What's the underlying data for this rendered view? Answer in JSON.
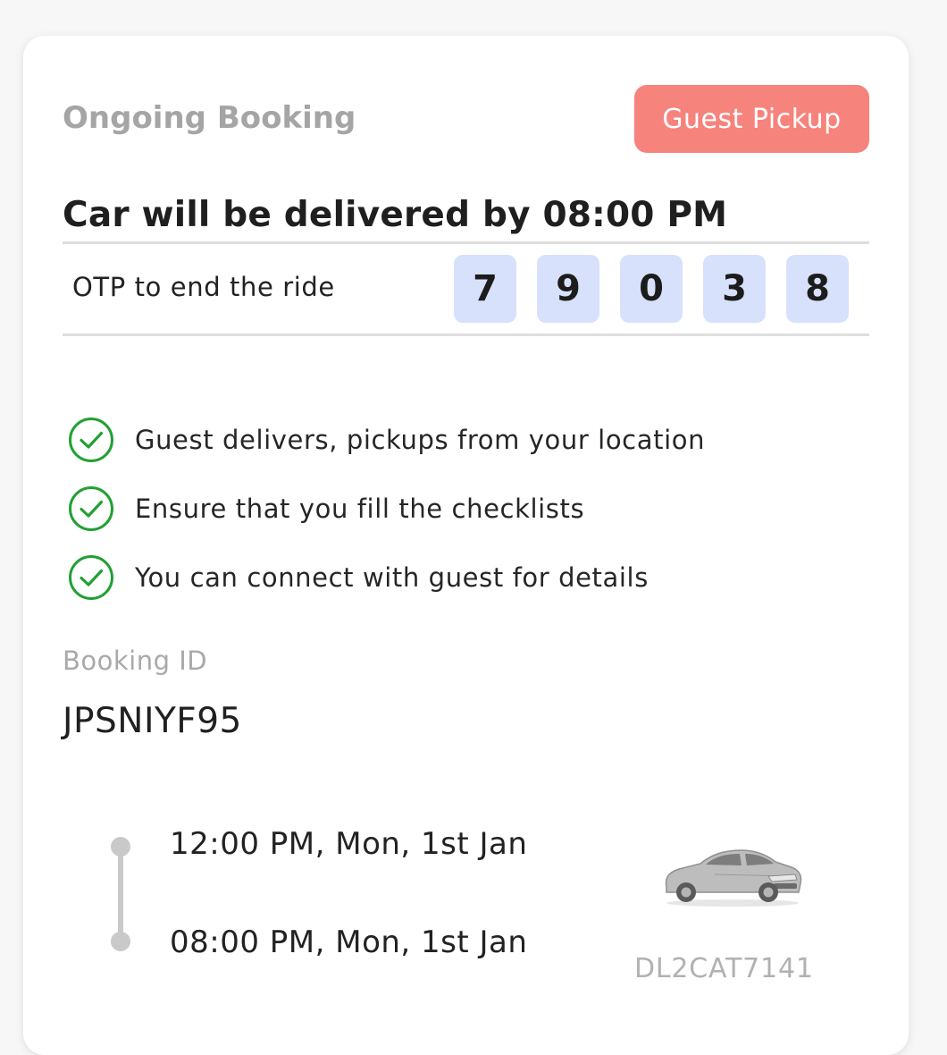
{
  "header": {
    "title": "Ongoing Booking",
    "badge_label": "Guest Pickup",
    "badge_color": "#f6837c"
  },
  "delivery": {
    "heading": "Car will be delivered by 08:00 PM"
  },
  "otp": {
    "label": "OTP to end the ride",
    "digits": [
      "7",
      "9",
      "0",
      "3",
      "8"
    ]
  },
  "features": [
    {
      "text": "Guest delivers, pickups from your location",
      "icon": "check-circle-icon"
    },
    {
      "text": "Ensure that you fill the checklists",
      "icon": "check-circle-icon"
    },
    {
      "text": "You can connect with guest for details",
      "icon": "check-circle-icon"
    }
  ],
  "booking": {
    "id_label": "Booking ID",
    "id_value": "JPSNIYF95"
  },
  "timeline": {
    "start": "12:00 PM, Mon, 1st Jan",
    "end": "08:00 PM, Mon, 1st Jan"
  },
  "car": {
    "icon": "car-image",
    "plate": "DL2CAT7141"
  },
  "colors": {
    "accent_green": "#22a033",
    "otp_bg": "#d8e1fb"
  }
}
